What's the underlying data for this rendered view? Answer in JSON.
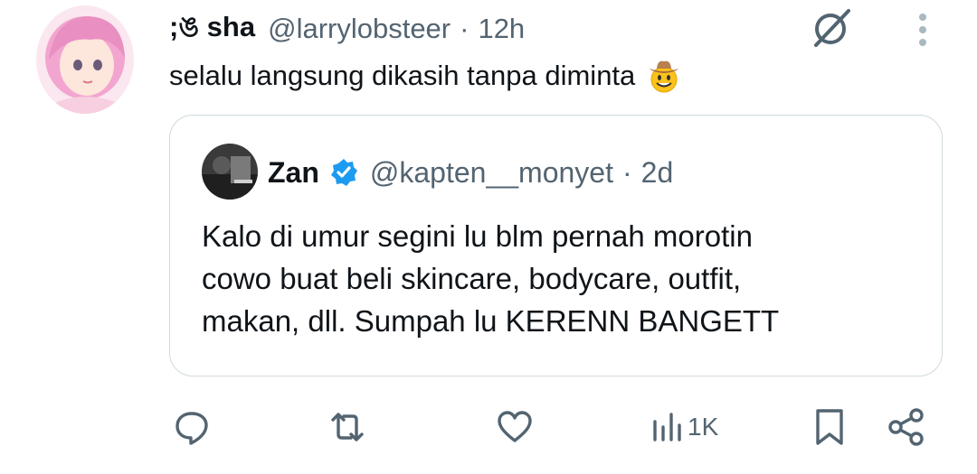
{
  "tweet": {
    "display_name": ";ঙ sha",
    "handle": "@larrylobsteer",
    "separator": "·",
    "time": "12h",
    "text": "selalu langsung dikasih tanpa diminta",
    "emoji": "cowboy-face-emoji"
  },
  "quote": {
    "display_name": "Zan",
    "verified": true,
    "handle": "@kapten__monyet",
    "separator": "·",
    "time": "2d",
    "lines": [
      "Kalo di umur segini lu blm pernah morotin",
      "cowo buat beli skincare, bodycare, outfit,",
      "makan, dll. Sumpah lu KERENN BANGETT"
    ]
  },
  "actions": {
    "reply_icon": "reply-icon",
    "retweet_icon": "retweet-icon",
    "like_icon": "like-icon",
    "views_icon": "views-icon",
    "views_count": "1K",
    "bookmark_icon": "bookmark-icon",
    "share_icon": "share-icon"
  },
  "colors": {
    "text": "#0f1419",
    "secondary": "#536471",
    "border": "#cfd9de",
    "verified": "#1d9bf0"
  }
}
